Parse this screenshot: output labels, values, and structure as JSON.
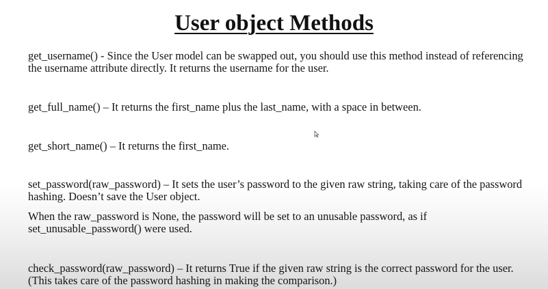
{
  "title": "User object Methods",
  "paragraphs": [
    "get_username() - Since the User model can be swapped out, you should use this method instead of referencing the username attribute directly. It returns the username for the user.",
    "get_full_name() – It returns the first_name plus the last_name, with a space in between.",
    "get_short_name() – It returns the first_name.",
    "set_password(raw_password) – It sets the user’s password to the given raw string, taking care of the password hashing. Doesn’t save the User object.",
    "When the raw_password is None, the password will be set to an unusable password, as if set_unusable_password() were used.",
    "check_password(raw_password) – It returns True if the given raw string is the correct password for the user. (This takes care of the password hashing in making the comparison.)"
  ],
  "icons": {
    "cursor": "mouse-pointer-icon"
  }
}
